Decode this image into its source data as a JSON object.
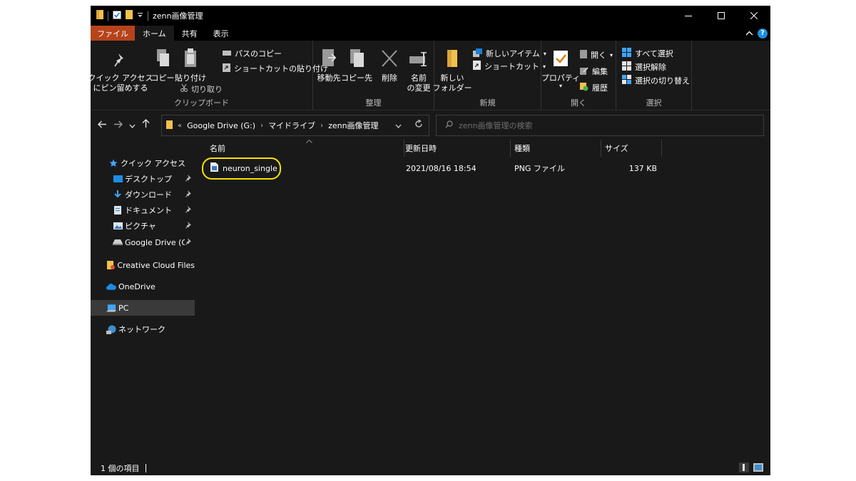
{
  "window": {
    "title": "zenn画像管理",
    "accent_color": "#b5431b"
  },
  "tabs": [
    {
      "label": "ファイル"
    },
    {
      "label": "ホーム"
    },
    {
      "label": "共有"
    },
    {
      "label": "表示"
    }
  ],
  "ribbon": {
    "clipboard": {
      "pin_line1": "クイック アクセス",
      "pin_line2": "にピン留めする",
      "copy": "コピー",
      "paste": "貼り付け",
      "copy_path": "パスのコピー",
      "paste_shortcut": "ショートカットの貼り付け",
      "cut": "切り取り",
      "label": "クリップボード"
    },
    "organize": {
      "move_to": "移動先",
      "copy_to": "コピー先",
      "delete": "削除",
      "rename_line1": "名前",
      "rename_line2": "の変更",
      "label": "整理"
    },
    "new": {
      "new_folder_line1": "新しい",
      "new_folder_line2": "フォルダー",
      "new_item": "新しいアイテム",
      "easy_access": "ショートカット",
      "label": "新規"
    },
    "open": {
      "properties": "プロパティ",
      "open": "開く",
      "edit": "編集",
      "history": "履歴",
      "label": "開く"
    },
    "select": {
      "select_all": "すべて選択",
      "select_none": "選択解除",
      "invert": "選択の切り替え",
      "label": "選択"
    }
  },
  "address": {
    "overflow": "«",
    "crumbs": [
      "Google Drive (G:)",
      "マイドライブ",
      "zenn画像管理"
    ],
    "search_placeholder": "zenn画像管理の検索"
  },
  "nav": {
    "quick_access": "クイック アクセス",
    "desktop": "デスクトップ",
    "downloads": "ダウンロード",
    "documents": "ドキュメント",
    "pictures": "ピクチャ",
    "google_drive": "Google Drive (G:)",
    "creative_cloud": "Creative Cloud Files",
    "onedrive": "OneDrive",
    "pc": "PC",
    "network": "ネットワーク"
  },
  "columns": {
    "name": "名前",
    "modified": "更新日時",
    "type": "種類",
    "size": "サイズ"
  },
  "files": [
    {
      "name": "neuron_single",
      "modified": "2021/08/16 18:54",
      "type": "PNG ファイル",
      "size": "137 KB"
    }
  ],
  "status": {
    "item_count": "1 個の項目"
  }
}
